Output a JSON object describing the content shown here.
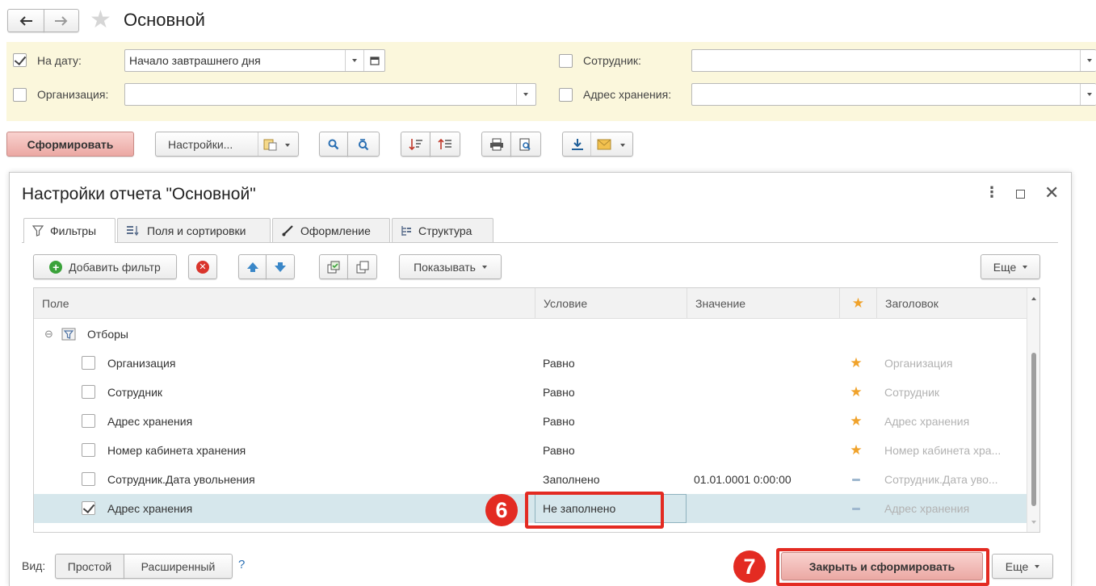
{
  "window": {
    "title": "Основной"
  },
  "filters": {
    "date_label": "На дату:",
    "date_value": "Начало завтрашнего дня",
    "employee_label": "Сотрудник:",
    "employee_value": "",
    "org_label": "Организация:",
    "org_value": "",
    "storage_label": "Адрес хранения:",
    "storage_value": ""
  },
  "toolbar": {
    "generate": "Сформировать",
    "settings": "Настройки..."
  },
  "dialog": {
    "title": "Настройки отчета \"Основной\"",
    "tabs": [
      "Фильтры",
      "Поля и сортировки",
      "Оформление",
      "Структура"
    ],
    "add_filter": "Добавить фильтр",
    "show": "Показывать",
    "more": "Еще",
    "columns": {
      "field": "Поле",
      "condition": "Условие",
      "value": "Значение",
      "title": "Заголовок"
    },
    "group": "Отборы",
    "rows": [
      {
        "field": "Организация",
        "condition": "Равно",
        "value": "",
        "mark": "star",
        "title": "Организация",
        "checked": false
      },
      {
        "field": "Сотрудник",
        "condition": "Равно",
        "value": "",
        "mark": "star",
        "title": "Сотрудник",
        "checked": false
      },
      {
        "field": "Адрес хранения",
        "condition": "Равно",
        "value": "",
        "mark": "star",
        "title": "Адрес хранения",
        "checked": false
      },
      {
        "field": "Номер кабинета хранения",
        "condition": "Равно",
        "value": "",
        "mark": "star",
        "title": "Номер кабинета хра...",
        "checked": false
      },
      {
        "field": "Сотрудник.Дата увольнения",
        "condition": "Заполнено",
        "value": "01.01.0001 0:00:00",
        "mark": "dash",
        "title": "Сотрудник.Дата уво...",
        "checked": false
      },
      {
        "field": "Адрес хранения",
        "condition": "Не заполнено",
        "value": "",
        "mark": "dash",
        "title": "Адрес хранения",
        "checked": true
      }
    ],
    "view_label": "Вид:",
    "view_simple": "Простой",
    "view_extended": "Расширенный",
    "help": "?",
    "close_generate": "Закрыть и сформировать",
    "more_bottom": "Еще"
  },
  "annotations": {
    "step6": "6",
    "step7": "7"
  },
  "colors": {
    "accent_red": "#e32b22",
    "filter_bg": "#fbf7dc",
    "generate_btn": "#eba8a3"
  }
}
